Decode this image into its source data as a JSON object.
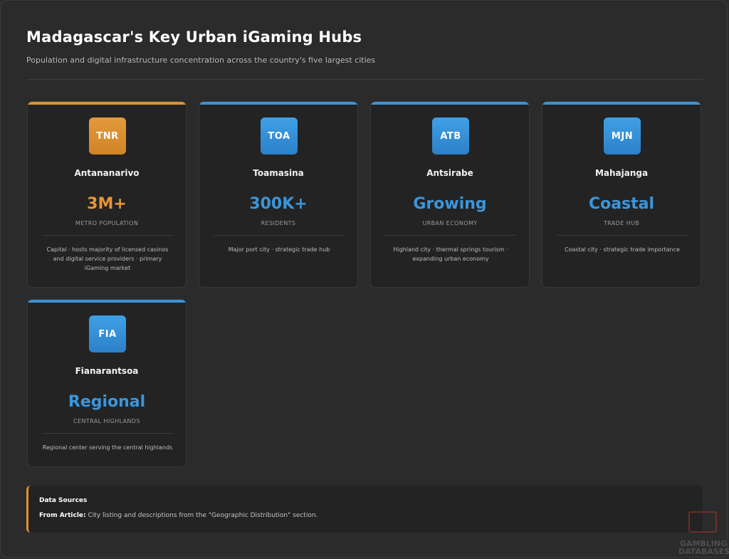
{
  "header": {
    "title": "Madagascar's Key Urban iGaming Hubs",
    "subtitle": "Population and digital infrastructure concentration across the country's five largest cities"
  },
  "cities": [
    {
      "code": "TNR",
      "name": "Antananarivo",
      "metric": "3M+",
      "metric_label": "METRO POPULATION",
      "description": "Capital · hosts majority of licensed casinos and digital service providers · primary iGaming market",
      "accent": "#e0922f"
    },
    {
      "code": "TOA",
      "name": "Toamasina",
      "metric": "300K+",
      "metric_label": "RESIDENTS",
      "description": "Major port city · strategic trade hub",
      "accent": "#3a93d8"
    },
    {
      "code": "ATB",
      "name": "Antsirabe",
      "metric": "Growing",
      "metric_label": "URBAN ECONOMY",
      "description": "Highland city · thermal springs tourism · expanding urban economy",
      "accent": "#3a93d8"
    },
    {
      "code": "MJN",
      "name": "Mahajanga",
      "metric": "Coastal",
      "metric_label": "TRADE HUB",
      "description": "Coastal city · strategic trade importance",
      "accent": "#3a93d8"
    },
    {
      "code": "FIA",
      "name": "Fianarantsoa",
      "metric": "Regional",
      "metric_label": "CENTRAL HIGHLANDS",
      "description": "Regional center serving the central highlands",
      "accent": "#3a93d8"
    }
  ],
  "sources": {
    "title": "Data Sources",
    "label": "From Article:",
    "text": "City listing and descriptions from the \"Geographic Distribution\" section."
  },
  "watermark": {
    "line1": "GAMBLING",
    "line2": "DATABASES"
  }
}
